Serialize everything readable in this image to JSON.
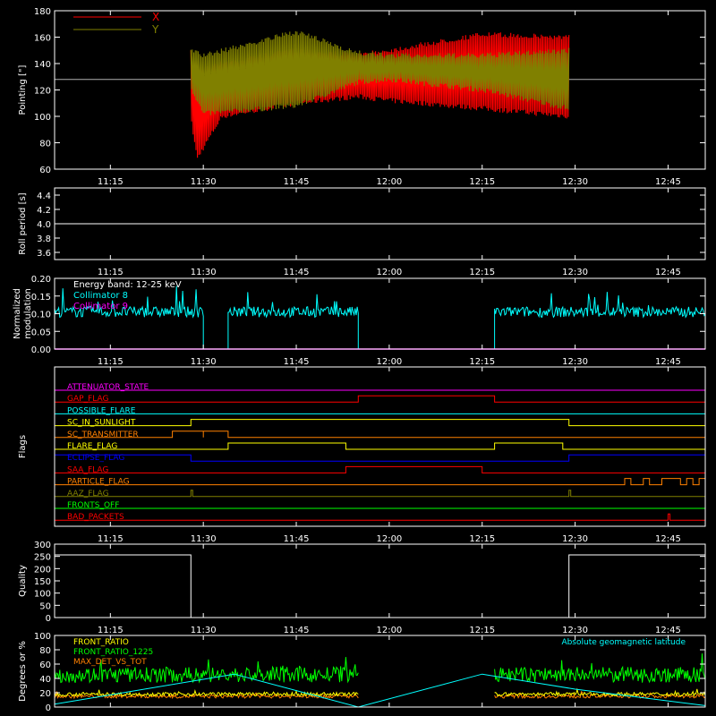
{
  "colors": {
    "background": "#000000",
    "axis": "#ffffff",
    "red": "#ff0000",
    "olive": "#808000",
    "cyan": "#00ffff",
    "magenta": "#ff00ff",
    "yellow": "#ffff00",
    "orange": "#ff8000",
    "green": "#00ff00",
    "blue": "#0000ff",
    "white": "#ffffff"
  },
  "time_ticks": [
    "11:15",
    "11:30",
    "11:45",
    "12:00",
    "12:15",
    "12:30",
    "12:45"
  ],
  "chart_data": [
    {
      "type": "line",
      "ylabel": "Pointing [\"]",
      "ylim": [
        60,
        180
      ],
      "yticks": [
        "60",
        "80",
        "100",
        "120",
        "140",
        "160",
        "180"
      ],
      "time_range": [
        "11:06",
        "12:51"
      ],
      "legend": [
        "X",
        "Y"
      ],
      "series": [
        {
          "name": "X",
          "color": "red",
          "envelope": {
            "times": [
              "11:28",
              "11:29",
              "11:33",
              "11:45",
              "11:55",
              "12:00",
              "12:15",
              "12:29"
            ],
            "upper": [
              150,
              136,
              142,
              152,
              148,
              152,
              164,
              162
            ],
            "lower": [
              96,
              66,
              98,
              108,
              113,
              110,
              104,
              98
            ]
          }
        },
        {
          "name": "Y",
          "color": "olive",
          "envelope": {
            "times": [
              "11:28",
              "11:30",
              "11:45",
              "11:55",
              "12:00",
              "12:15",
              "12:29"
            ],
            "upper": [
              153,
              148,
              166,
              150,
              148,
              148,
              152
            ],
            "lower": [
              120,
              100,
              106,
              124,
              126,
              118,
              104
            ]
          }
        }
      ],
      "reference_line": 128
    },
    {
      "type": "line",
      "ylabel": "Roll period [s]",
      "ylim": [
        3.5,
        4.5
      ],
      "yticks": [
        "3.6",
        "3.8",
        "4.0",
        "4.2",
        "4.4"
      ],
      "series": [
        {
          "color": "white",
          "value": 4.0
        }
      ]
    },
    {
      "type": "line",
      "ylabel": "Normalized modulation",
      "ylim": [
        0.0,
        0.2
      ],
      "yticks": [
        "0.00",
        "0.05",
        "0.10",
        "0.15",
        "0.20"
      ],
      "legend": [
        "Energy band: 12-25 keV",
        "Collimator 8",
        "Collimator 9"
      ],
      "series": [
        {
          "name": "Collimator 8",
          "color": "cyan",
          "segments": [
            [
              "11:06",
              "11:30"
            ],
            [
              "11:34",
              "11:55"
            ],
            [
              "12:17",
              "12:51"
            ]
          ],
          "mean": 0.105
        },
        {
          "name": "Collimator 9",
          "color": "magenta",
          "value": 0.0
        }
      ]
    },
    {
      "type": "line",
      "ylabel": "Flags",
      "flags": [
        {
          "name": "ATTENUATOR_STATE",
          "color": "magenta",
          "on": []
        },
        {
          "name": "GAP_FLAG",
          "color": "red",
          "on": [
            [
              "11:55",
              "12:17"
            ]
          ]
        },
        {
          "name": "POSSIBLE_FLARE",
          "color": "cyan",
          "on": []
        },
        {
          "name": "SC_IN_SUNLIGHT",
          "color": "yellow",
          "on": [
            [
              "11:28",
              "12:29"
            ]
          ]
        },
        {
          "name": "SC_TRANSMITTER",
          "color": "orange",
          "on": [
            [
              "11:25",
              "11:30"
            ],
            [
              "11:30",
              "11:34"
            ]
          ]
        },
        {
          "name": "FLARE_FLAG",
          "color": "yellow",
          "on": [
            [
              "11:34",
              "11:53"
            ],
            [
              "12:17",
              "12:28"
            ]
          ]
        },
        {
          "name": "ECLIPSE_FLAG",
          "color": "blue",
          "on": [
            [
              "11:06",
              "11:28"
            ],
            [
              "12:29",
              "12:51"
            ]
          ]
        },
        {
          "name": "SAA_FLAG",
          "color": "red",
          "on": [
            [
              "11:53",
              "12:15"
            ]
          ]
        },
        {
          "name": "PARTICLE_FLAG",
          "color": "orange",
          "on": [
            [
              "12:38",
              "12:39"
            ],
            [
              "12:41",
              "12:42"
            ],
            [
              "12:44",
              "12:47"
            ],
            [
              "12:48",
              "12:49"
            ],
            [
              "12:50",
              "12:51"
            ]
          ]
        },
        {
          "name": "AAZ_FLAG",
          "color": "olive",
          "on": [
            [
              "11:28",
              "11:28"
            ],
            [
              "12:29",
              "12:29"
            ]
          ]
        },
        {
          "name": "FRONTS_OFF",
          "color": "green",
          "on": []
        },
        {
          "name": "BAD_PACKETS",
          "color": "red",
          "on": [
            [
              "12:45",
              "12:45"
            ]
          ]
        }
      ]
    },
    {
      "type": "line",
      "ylabel": "Quality",
      "ylim": [
        0,
        300
      ],
      "yticks": [
        "0",
        "50",
        "100",
        "150",
        "200",
        "250",
        "300"
      ],
      "series": [
        {
          "color": "white",
          "points": [
            [
              "11:06",
              256
            ],
            [
              "11:28",
              256
            ],
            [
              "11:28",
              0
            ],
            [
              "12:29",
              0
            ],
            [
              "12:29",
              256
            ],
            [
              "12:51",
              256
            ]
          ]
        }
      ]
    },
    {
      "type": "line",
      "ylabel": "Degrees or %",
      "ylim": [
        0,
        100
      ],
      "yticks": [
        "0",
        "20",
        "40",
        "60",
        "80",
        "100"
      ],
      "legend": [
        "FRONT_RATIO",
        "FRONT_RATIO_1225",
        "MAX_DET_VS_TOT"
      ],
      "annotation": "Absolute geomagnetic latitude",
      "series": [
        {
          "name": "FRONT_RATIO",
          "color": "yellow",
          "mean": 18,
          "gap": [
            "11:55",
            "12:17"
          ]
        },
        {
          "name": "FRONT_RATIO_1225",
          "color": "green",
          "mean": 45,
          "gap": [
            "11:55",
            "12:17"
          ]
        },
        {
          "name": "MAX_DET_VS_TOT",
          "color": "orange",
          "mean": 15,
          "gap": [
            "11:55",
            "12:17"
          ]
        },
        {
          "name": "Absolute geomagnetic latitude",
          "color": "cyan",
          "points": [
            [
              "11:06",
              4
            ],
            [
              "11:35",
              46
            ],
            [
              "11:55",
              0
            ],
            [
              "12:15",
              46
            ],
            [
              "12:30",
              25
            ],
            [
              "12:51",
              2
            ]
          ]
        }
      ]
    }
  ]
}
